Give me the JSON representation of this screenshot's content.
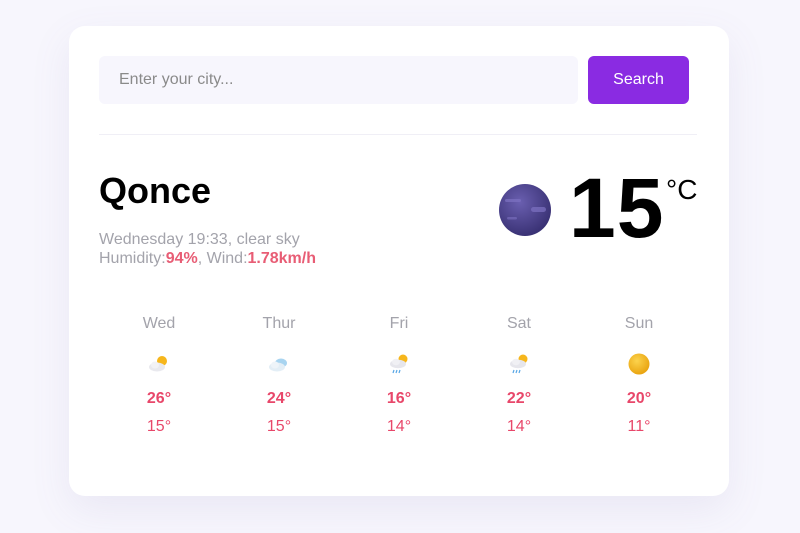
{
  "search": {
    "placeholder": "Enter your city...",
    "value": "",
    "button_label": "Search"
  },
  "current": {
    "city": "Qonce",
    "description": "Wednesday 19:33, clear sky",
    "humidity_label": "Humidity:",
    "humidity_value": "94%",
    "wind_label": "Wind:",
    "wind_value": "1.78km/h",
    "temperature": "15",
    "unit": "°C",
    "icon": "moon-clear-night-icon"
  },
  "forecast": [
    {
      "day": "Wed",
      "high": "26°",
      "low": "15°",
      "icon": "partly-cloudy-icon"
    },
    {
      "day": "Thur",
      "high": "24°",
      "low": "15°",
      "icon": "cloudy-icon"
    },
    {
      "day": "Fri",
      "high": "16°",
      "low": "14°",
      "icon": "sun-cloud-rain-icon"
    },
    {
      "day": "Sat",
      "high": "22°",
      "low": "14°",
      "icon": "sun-cloud-rain-icon"
    },
    {
      "day": "Sun",
      "high": "20°",
      "low": "11°",
      "icon": "sunny-icon"
    }
  ],
  "colors": {
    "accent": "#8a2be2",
    "highlight": "#e85d75",
    "temp_text": "#e8476a",
    "muted": "#a3a3ab"
  }
}
